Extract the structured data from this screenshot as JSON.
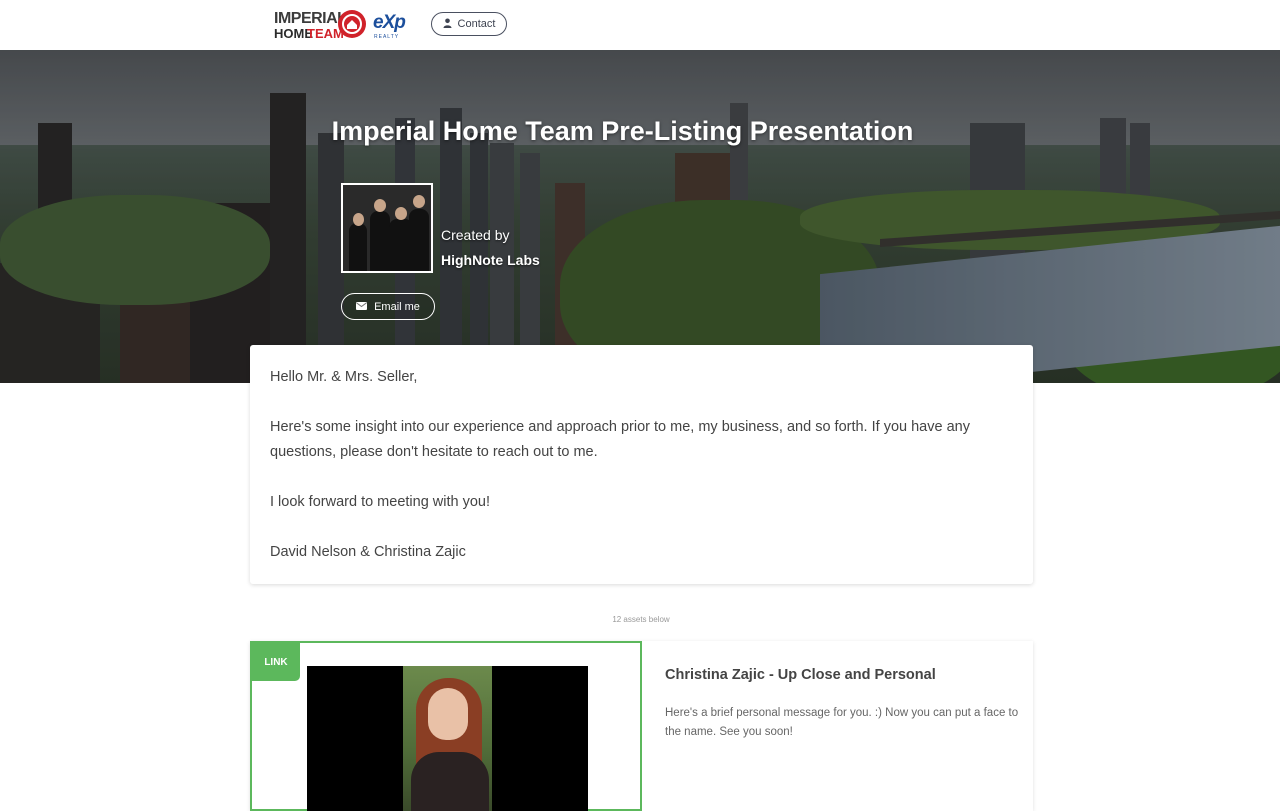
{
  "header": {
    "logo": {
      "word1": "IMPERIAL",
      "word2": "HOME",
      "word3": "TEAM",
      "brand": "eXp",
      "brand_sub": "REALTY"
    },
    "contact_label": "Contact"
  },
  "hero": {
    "title": "Imperial Home Team Pre-Listing Presentation",
    "created_by_label": "Created by",
    "creator": "HighNote Labs",
    "email_label": "Email me"
  },
  "message": {
    "greeting": "Hello Mr. & Mrs. Seller,",
    "body": "Here's some insight into our experience and approach prior to me, my business, and so forth.  If you have any questions, please don't hesitate to reach out to me.",
    "closing": "I look forward to meeting with you!",
    "signature": "David Nelson & Christina Zajic"
  },
  "assets": {
    "count_text": "12 assets below",
    "items": [
      {
        "badge": "LINK",
        "title": "Christina Zajic - Up Close and Personal",
        "description": "Here's a brief personal message for you.  :)  Now you can put a face to the name.  See you soon!"
      }
    ]
  },
  "colors": {
    "accent_green": "#5cb85c",
    "brand_red": "#d0222a",
    "brand_blue": "#1c4f9c"
  }
}
